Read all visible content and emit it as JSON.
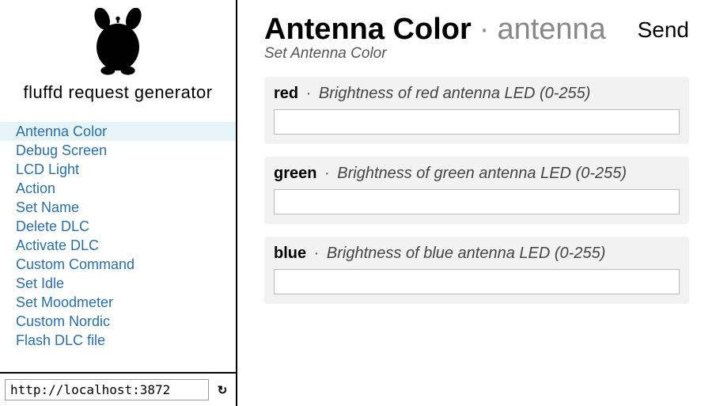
{
  "brand": {
    "title": "fluffd request generator"
  },
  "nav": {
    "items": [
      {
        "label": "Antenna Color",
        "active": true
      },
      {
        "label": "Debug Screen",
        "active": false
      },
      {
        "label": "LCD Light",
        "active": false
      },
      {
        "label": "Action",
        "active": false
      },
      {
        "label": "Set Name",
        "active": false
      },
      {
        "label": "Delete DLC",
        "active": false
      },
      {
        "label": "Activate DLC",
        "active": false
      },
      {
        "label": "Custom Command",
        "active": false
      },
      {
        "label": "Set Idle",
        "active": false
      },
      {
        "label": "Set Moodmeter",
        "active": false
      },
      {
        "label": "Custom Nordic",
        "active": false
      },
      {
        "label": "Flash DLC file",
        "active": false
      }
    ]
  },
  "footer": {
    "url_value": "http://localhost:3872",
    "reload_glyph": "↻"
  },
  "page": {
    "title": "Antenna Color",
    "separator": "·",
    "slug": "antenna",
    "subtitle": "Set Antenna Color",
    "send_label": "Send"
  },
  "params": [
    {
      "name": "red",
      "desc": "Brightness of red antenna LED (0-255)",
      "value": ""
    },
    {
      "name": "green",
      "desc": "Brightness of green antenna LED (0-255)",
      "value": ""
    },
    {
      "name": "blue",
      "desc": "Brightness of blue antenna LED (0-255)",
      "value": ""
    }
  ]
}
